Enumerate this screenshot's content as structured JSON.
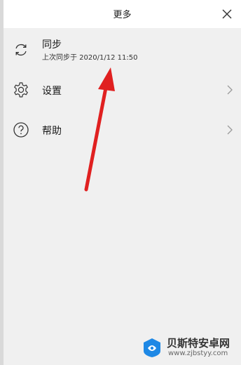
{
  "header": {
    "title": "更多"
  },
  "menu": {
    "sync": {
      "label": "同步",
      "sublabel": "上次同步于 2020/1/12 11:50",
      "icon": "sync-icon"
    },
    "settings": {
      "label": "设置",
      "icon": "gear-icon"
    },
    "help": {
      "label": "帮助",
      "icon": "help-circle-icon"
    }
  },
  "annotation": {
    "arrow_color": "#e02020"
  },
  "watermark": {
    "title": "贝斯特安卓网",
    "url": "www.zjbstyy.com"
  },
  "colors": {
    "header_bg": "#ffffff",
    "panel_bg": "#f0f0f0"
  }
}
